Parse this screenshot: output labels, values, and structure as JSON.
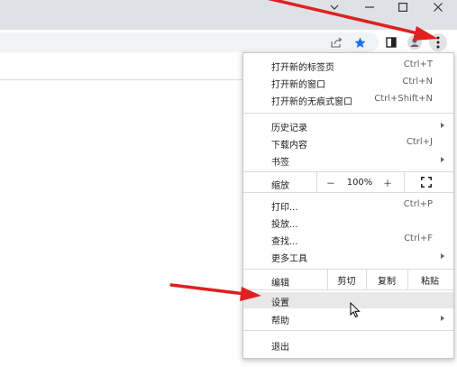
{
  "window": {
    "minimize_icon": "chevron-down-icon",
    "colors": {
      "titlebar": "#dee1e6",
      "annotation_arrow": "#e02020",
      "bookmark_star": "#1a73e8"
    }
  },
  "menu": {
    "new_tab": {
      "label": "打开新的标签页",
      "shortcut": "Ctrl+T"
    },
    "new_window": {
      "label": "打开新的窗口",
      "shortcut": "Ctrl+N"
    },
    "new_incognito": {
      "label": "打开新的无痕式窗口",
      "shortcut": "Ctrl+Shift+N"
    },
    "history": {
      "label": "历史记录"
    },
    "downloads": {
      "label": "下载内容",
      "shortcut": "Ctrl+J"
    },
    "bookmarks": {
      "label": "书签"
    },
    "zoom": {
      "label": "缩放",
      "minus": "－",
      "value": "100%",
      "plus": "＋"
    },
    "print": {
      "label": "打印...",
      "shortcut": "Ctrl+P"
    },
    "cast": {
      "label": "投放..."
    },
    "find": {
      "label": "查找...",
      "shortcut": "Ctrl+F"
    },
    "more_tools": {
      "label": "更多工具"
    },
    "edit": {
      "label": "编辑",
      "cut": "剪切",
      "copy": "复制",
      "paste": "粘贴"
    },
    "settings": {
      "label": "设置"
    },
    "help": {
      "label": "帮助"
    },
    "exit": {
      "label": "退出"
    }
  }
}
